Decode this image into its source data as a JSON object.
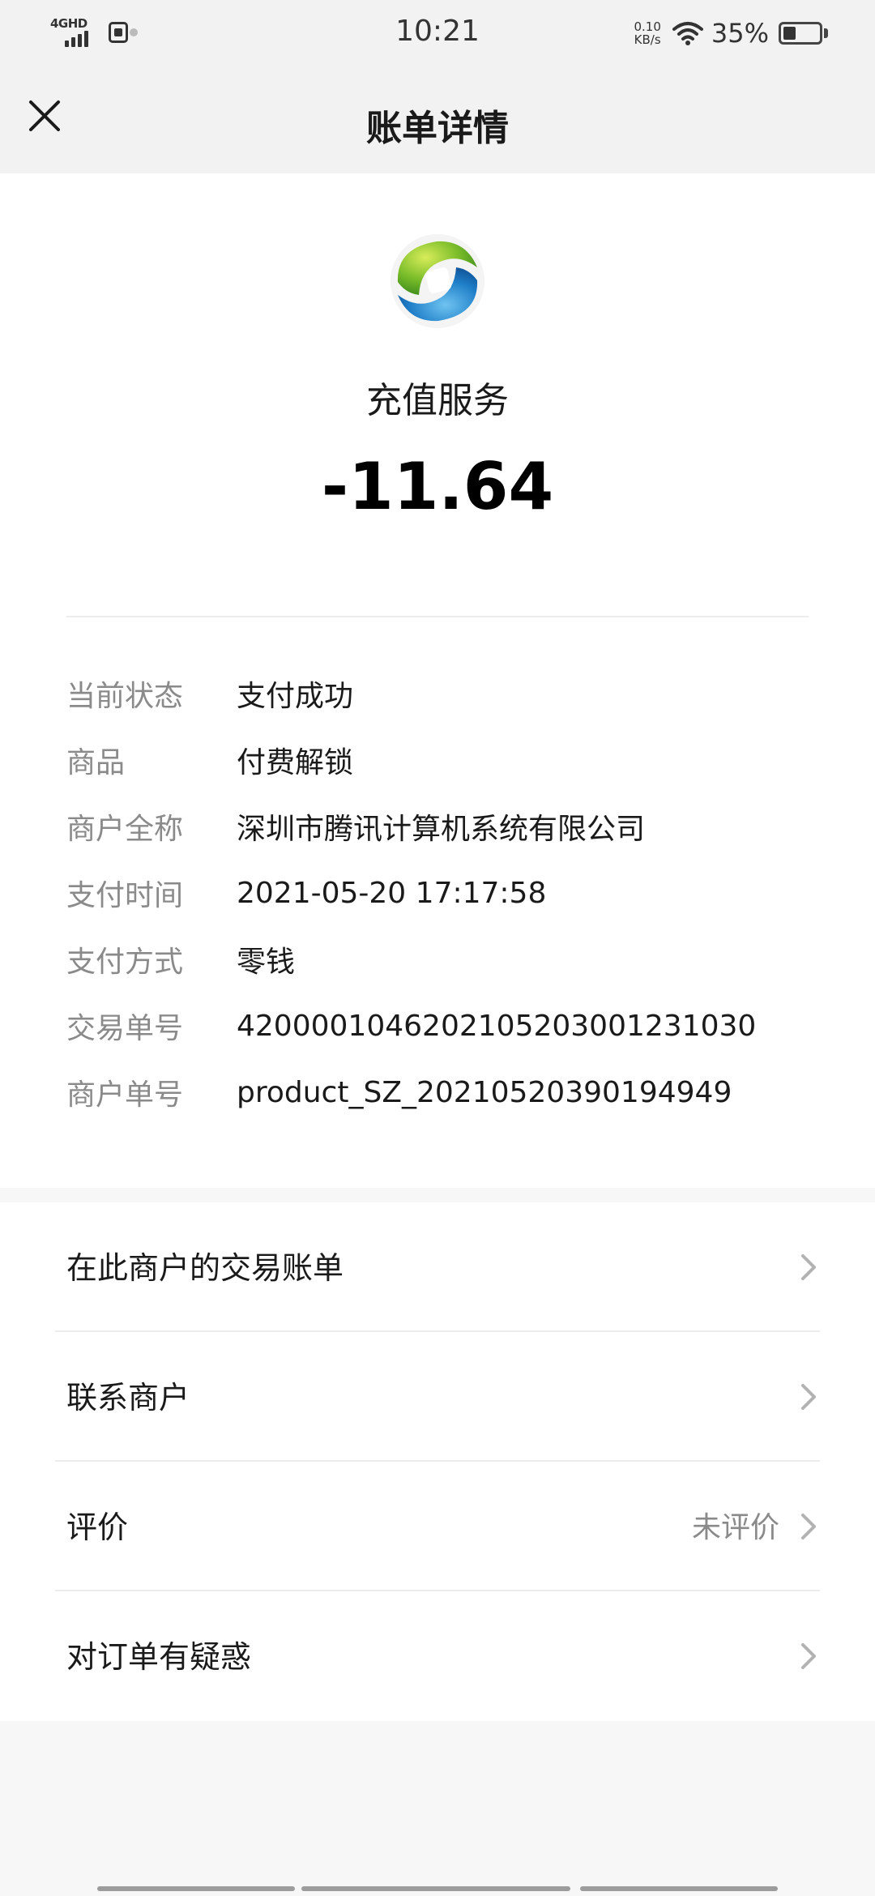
{
  "status_bar": {
    "network": "4GHD",
    "time": "10:21",
    "speed_value": "0.10",
    "speed_unit": "KB/s",
    "battery": "35%",
    "battery_level": 0.35
  },
  "nav": {
    "title": "账单详情"
  },
  "bill": {
    "merchant_name": "充值服务",
    "amount": "-11.64"
  },
  "details": [
    {
      "label": "当前状态",
      "value": "支付成功"
    },
    {
      "label": "商品",
      "value": "付费解锁"
    },
    {
      "label": "商户全称",
      "value": "深圳市腾讯计算机系统有限公司"
    },
    {
      "label": "支付时间",
      "value": "2021-05-20 17:17:58"
    },
    {
      "label": "支付方式",
      "value": "零钱"
    },
    {
      "label": "交易单号",
      "value": "4200001046202105203001231030"
    },
    {
      "label": "商户单号",
      "value": "product_SZ_20210520390194949"
    }
  ],
  "actions": [
    {
      "label": "在此商户的交易账单",
      "extra": ""
    },
    {
      "label": "联系商户",
      "extra": ""
    },
    {
      "label": "评价",
      "extra": "未评价"
    },
    {
      "label": "对订单有疑惑",
      "extra": ""
    }
  ],
  "colors": {
    "background": "#f7f7f7",
    "card": "#ffffff",
    "label_gray": "#8a8a8a",
    "text": "#1a1a1a"
  },
  "icons": {
    "close": "close-icon",
    "chevron": "chevron-right-icon",
    "merchant": "merchant-logo-icon"
  }
}
